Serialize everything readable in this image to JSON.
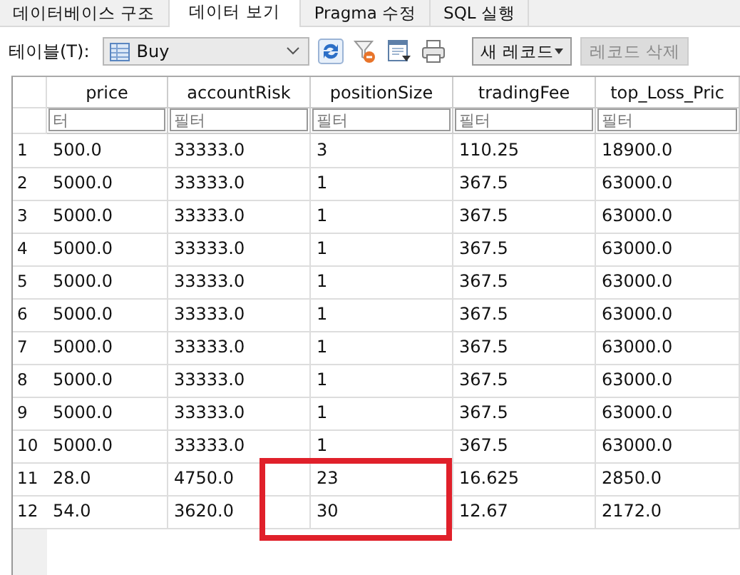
{
  "tabs": [
    {
      "label": "데이터베이스 구조",
      "selected": false
    },
    {
      "label": "데이터 보기",
      "selected": true
    },
    {
      "label": "Pragma 수정",
      "selected": false
    },
    {
      "label": "SQL 실행",
      "selected": false
    }
  ],
  "toolbar": {
    "table_label": "테이블(T):",
    "table_select": "Buy",
    "new_record": "새 레코드",
    "delete_record": {
      "label": "레코드 삭제",
      "disabled": true
    }
  },
  "table": {
    "columns": [
      {
        "name": "price",
        "filter_placeholder": "터"
      },
      {
        "name": "accountRisk",
        "filter_placeholder": "필터"
      },
      {
        "name": "positionSize",
        "filter_placeholder": "필터"
      },
      {
        "name": "tradingFee",
        "filter_placeholder": "필터"
      },
      {
        "name": "top_Loss_Pric",
        "filter_placeholder": "필터"
      }
    ],
    "rows": [
      {
        "number": "1",
        "cells": [
          "500.0",
          "33333.0",
          "3",
          "110.25",
          "18900.0"
        ],
        "marked": false
      },
      {
        "number": "2",
        "cells": [
          "5000.0",
          "33333.0",
          "1",
          "367.5",
          "63000.0"
        ],
        "marked": false
      },
      {
        "number": "3",
        "cells": [
          "5000.0",
          "33333.0",
          "1",
          "367.5",
          "63000.0"
        ],
        "marked": false
      },
      {
        "number": "4",
        "cells": [
          "5000.0",
          "33333.0",
          "1",
          "367.5",
          "63000.0"
        ],
        "marked": false
      },
      {
        "number": "5",
        "cells": [
          "5000.0",
          "33333.0",
          "1",
          "367.5",
          "63000.0"
        ],
        "marked": false
      },
      {
        "number": "6",
        "cells": [
          "5000.0",
          "33333.0",
          "1",
          "367.5",
          "63000.0"
        ],
        "marked": false
      },
      {
        "number": "7",
        "cells": [
          "5000.0",
          "33333.0",
          "1",
          "367.5",
          "63000.0"
        ],
        "marked": false
      },
      {
        "number": "8",
        "cells": [
          "5000.0",
          "33333.0",
          "1",
          "367.5",
          "63000.0"
        ],
        "marked": false
      },
      {
        "number": "9",
        "cells": [
          "5000.0",
          "33333.0",
          "1",
          "367.5",
          "63000.0"
        ],
        "marked": false
      },
      {
        "number": "10",
        "cells": [
          "5000.0",
          "33333.0",
          "1",
          "367.5",
          "63000.0"
        ],
        "marked": false
      },
      {
        "number": "11",
        "cells": [
          "28.0",
          "4750.0",
          "23",
          "16.625",
          "2850.0"
        ],
        "marked": true
      },
      {
        "number": "12",
        "cells": [
          "54.0",
          "3620.0",
          "30",
          "12.67",
          "2172.0"
        ],
        "marked": true
      }
    ]
  }
}
